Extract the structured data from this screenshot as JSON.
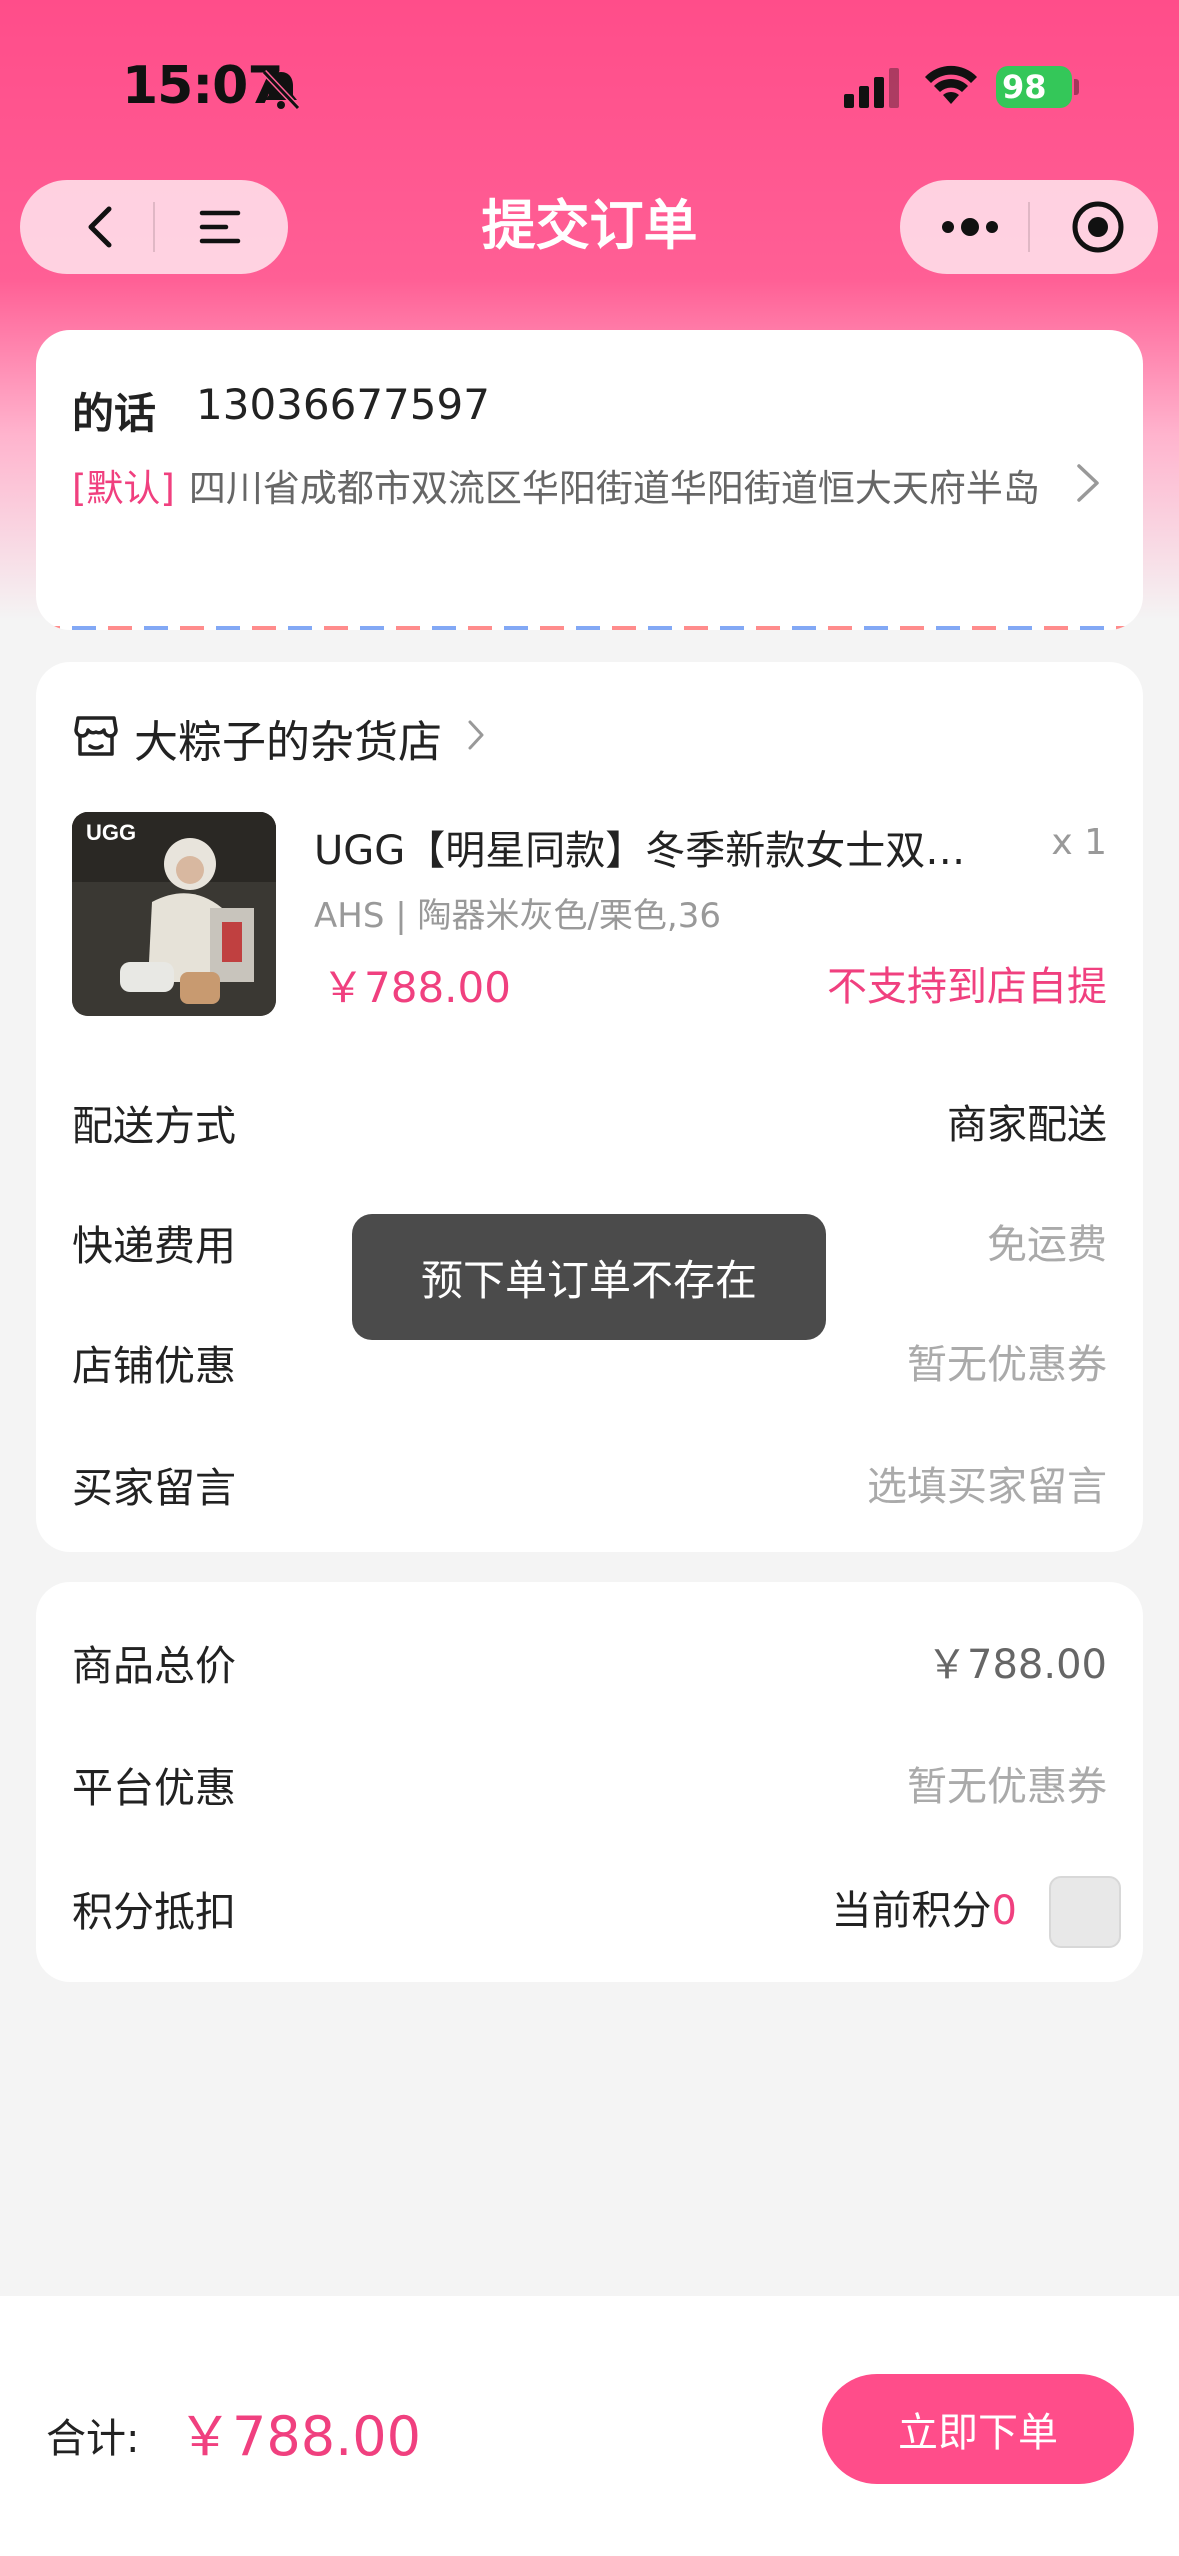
{
  "status_bar": {
    "time": "15:07",
    "battery": "98"
  },
  "nav": {
    "title": "提交订单"
  },
  "address": {
    "name": "的话",
    "phone": "13036677597",
    "tag": "[默认]",
    "detail": "四川省成都市双流区华阳街道华阳街道恒大天府半岛"
  },
  "shop": {
    "name": "大粽子的杂货店"
  },
  "product": {
    "title": "UGG【明星同款】冬季新款女士双…",
    "qty": "x 1",
    "spec": "AHS | 陶器米灰色/栗色,36",
    "price": "￥788.00",
    "pickup_note": "不支持到店自提"
  },
  "order_rows": [
    {
      "label": "配送方式",
      "value": "商家配送"
    },
    {
      "label": "快递费用",
      "value": "免运费"
    },
    {
      "label": "店铺优惠",
      "value": "暂无优惠券"
    },
    {
      "label": "买家留言",
      "value": "选填买家留言"
    }
  ],
  "summary": {
    "goods_total_label": "商品总价",
    "goods_total_value": "￥788.00",
    "platform_discount_label": "平台优惠",
    "platform_discount_value": "暂无优惠券",
    "points_label": "积分抵扣",
    "points_current_label": "当前积分",
    "points_value": "0"
  },
  "toast": {
    "text": "预下单订单不存在"
  },
  "footer": {
    "total_label": "合计:",
    "total_value": "￥788.00",
    "submit_label": "立即下单"
  },
  "colors": {
    "brand": "#ff4d8a",
    "accent_text": "#f0407f",
    "battery": "#34c759"
  }
}
